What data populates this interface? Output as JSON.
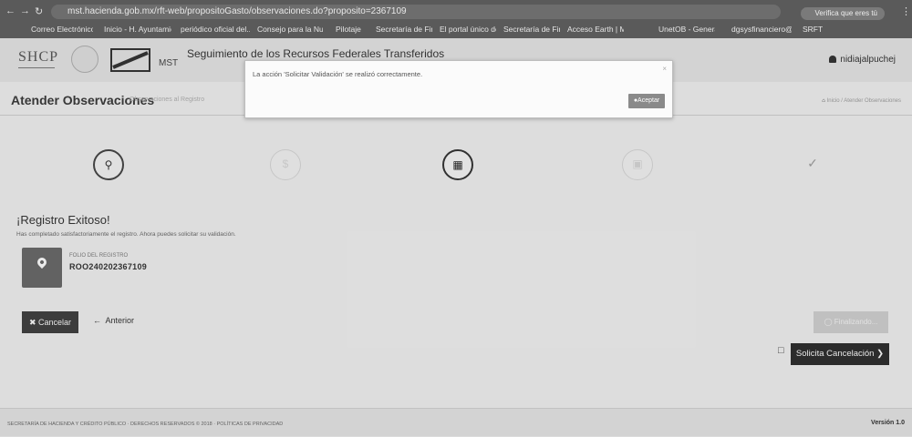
{
  "browser": {
    "url": "mst.hacienda.gob.mx/rft-web/propositoGasto/observaciones.do?proposito=2367109",
    "profile_label": "Verifica que eres tú",
    "bookmarks": [
      "Correo Electrónico",
      "Inicio - H. Ayuntamiento",
      "periódico oficial del...",
      "Consejo para la Nueva...",
      "Pilotaje",
      "Secretaría de Finanzas",
      "El portal único del g...",
      "Secretaría de Finanzas",
      "Acceso Earth | Mapas",
      "UnetOB - Generador",
      "dgsysfinanciero@gm...",
      "SRFT"
    ]
  },
  "header": {
    "logo_text": "SHCP",
    "mst_label": "MST",
    "system_title": "Seguimiento de los Recursos Federales Transferidos",
    "user_name": "nidiajalpuchej"
  },
  "page": {
    "title": "Atender Observaciones",
    "subtitle": "Observaciones al Registro",
    "breadcrumb_home": "Inicio",
    "breadcrumb_current": "Atender Observaciones"
  },
  "steps": [
    {
      "name": "location",
      "state": "done",
      "icon": "map-pin-icon"
    },
    {
      "name": "money",
      "state": "faded",
      "icon": "dollar-icon"
    },
    {
      "name": "document",
      "state": "current",
      "icon": "file-icon"
    },
    {
      "name": "image",
      "state": "faded",
      "icon": "image-icon"
    },
    {
      "name": "finish",
      "state": "finish",
      "icon": "check-icon"
    }
  ],
  "result": {
    "title": "¡Registro Exitoso!",
    "message": "Has completado satisfactoriamente el registro. Ahora puedes solicitar su validación.",
    "folio_label": "FOLIO DEL REGISTRO",
    "folio_value": "ROO240202367109"
  },
  "actions": {
    "cancel_label": "Cancelar",
    "previous_label": "Anterior",
    "finalize_label": "Finalizando...",
    "request_cancel_label": "Solicita Cancelación"
  },
  "footer": {
    "text": "SECRETARÍA DE HACIENDA Y CRÉDITO PÚBLICO · DERECHOS RESERVADOS © 2018 · POLÍTICAS DE PRIVACIDAD",
    "version": "Versión 1.0"
  },
  "modal": {
    "message": "La acción 'Solicitar Validación' se realizó correctamente.",
    "accept_label": "Aceptar"
  },
  "colors": {
    "dark_button": "#3f3f3f",
    "page_bg": "#e7e7e7"
  }
}
